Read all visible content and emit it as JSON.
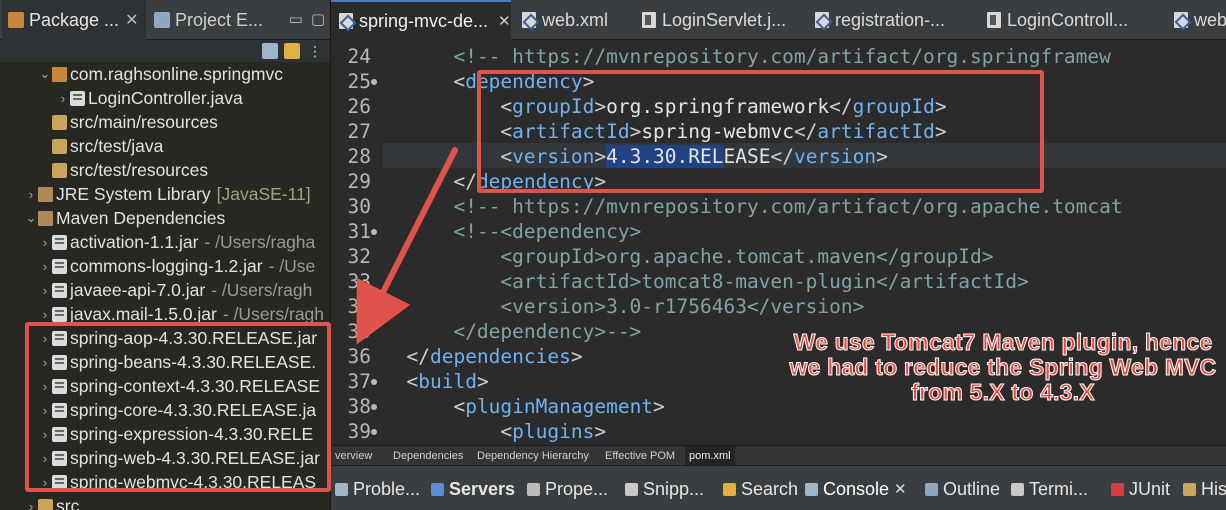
{
  "left_panel": {
    "tabs": [
      {
        "label": "Package ...",
        "closable": true
      },
      {
        "label": "Project E...",
        "closable": false
      }
    ],
    "tree": [
      {
        "label": "com.raghsonline.springmvc",
        "decoration": "",
        "icon": "package-icon",
        "expanded": true
      },
      {
        "label": "LoginController.java",
        "decoration": "",
        "icon": "java-file-icon",
        "expanded": false
      },
      {
        "label": "src/main/resources",
        "decoration": "",
        "icon": "source-folder-icon"
      },
      {
        "label": "src/test/java",
        "decoration": "",
        "icon": "source-folder-icon"
      },
      {
        "label": "src/test/resources",
        "decoration": "",
        "icon": "source-folder-icon"
      },
      {
        "label": "JRE System Library",
        "decoration": "[JavaSE-11]",
        "icon": "library-icon",
        "expanded": false
      },
      {
        "label": "Maven Dependencies",
        "decoration": "",
        "icon": "library-icon",
        "expanded": true
      },
      {
        "label": "activation-1.1.jar",
        "decoration": "- /Users/ragha",
        "icon": "jar-icon"
      },
      {
        "label": "commons-logging-1.2.jar",
        "decoration": "- /Use",
        "icon": "jar-icon"
      },
      {
        "label": "javaee-api-7.0.jar",
        "decoration": "- /Users/ragh",
        "icon": "jar-icon"
      },
      {
        "label": "javax.mail-1.5.0.jar",
        "decoration": "- /Users/ragh",
        "icon": "jar-icon"
      },
      {
        "label": "spring-aop-4.3.30.RELEASE.jar",
        "decoration": "",
        "icon": "jar-icon"
      },
      {
        "label": "spring-beans-4.3.30.RELEASE.",
        "decoration": "",
        "icon": "jar-icon"
      },
      {
        "label": "spring-context-4.3.30.RELEASE",
        "decoration": "",
        "icon": "jar-icon"
      },
      {
        "label": "spring-core-4.3.30.RELEASE.ja",
        "decoration": "",
        "icon": "jar-icon"
      },
      {
        "label": "spring-expression-4.3.30.RELE",
        "decoration": "",
        "icon": "jar-icon"
      },
      {
        "label": "spring-web-4.3.30.RELEASE.jar",
        "decoration": "",
        "icon": "jar-icon"
      },
      {
        "label": "spring-webmvc-4.3.30.RELEAS",
        "decoration": "",
        "icon": "jar-icon"
      },
      {
        "label": "src",
        "decoration": "",
        "icon": "folder-icon"
      }
    ]
  },
  "editor": {
    "tabs": [
      {
        "label": "spring-mvc-de...",
        "active": true,
        "closable": true,
        "icon": "xml-file-icon"
      },
      {
        "label": "web.xml",
        "active": false,
        "icon": "xml-file-icon"
      },
      {
        "label": "LoginServlet.j...",
        "active": false,
        "icon": "java-file-icon"
      },
      {
        "label": "registration-...",
        "active": false,
        "icon": "xml-file-icon"
      },
      {
        "label": "LoginControll...",
        "active": false,
        "icon": "java-file-icon"
      },
      {
        "label": "web.x",
        "active": false,
        "icon": "xml-file-icon"
      }
    ],
    "lines": [
      {
        "num": "24",
        "fold": false,
        "indent": "      ",
        "tokens": [
          {
            "t": "<!-- https://mvnrepository.com/artifact/org.springframew",
            "c": "cmt"
          }
        ]
      },
      {
        "num": "25",
        "fold": true,
        "indent": "      ",
        "tokens": [
          {
            "t": "<",
            "c": "br"
          },
          {
            "t": "dependency",
            "c": "tag"
          },
          {
            "t": ">",
            "c": "br"
          }
        ]
      },
      {
        "num": "26",
        "fold": false,
        "indent": "          ",
        "tokens": [
          {
            "t": "<",
            "c": "br"
          },
          {
            "t": "groupId",
            "c": "tag"
          },
          {
            "t": ">",
            "c": "br"
          },
          {
            "t": "org.springframework",
            "c": "txt"
          },
          {
            "t": "</",
            "c": "br"
          },
          {
            "t": "groupId",
            "c": "tag"
          },
          {
            "t": ">",
            "c": "br"
          }
        ]
      },
      {
        "num": "27",
        "fold": false,
        "indent": "          ",
        "tokens": [
          {
            "t": "<",
            "c": "br"
          },
          {
            "t": "artifactId",
            "c": "tag"
          },
          {
            "t": ">",
            "c": "br"
          },
          {
            "t": "spring-webmvc",
            "c": "txt"
          },
          {
            "t": "</",
            "c": "br"
          },
          {
            "t": "artifactId",
            "c": "tag"
          },
          {
            "t": ">",
            "c": "br"
          }
        ]
      },
      {
        "num": "28",
        "fold": false,
        "indent": "          ",
        "tokens": [
          {
            "t": "<",
            "c": "br"
          },
          {
            "t": "version",
            "c": "tag"
          },
          {
            "t": ">",
            "c": "br"
          },
          {
            "t": "4.3.30.REL",
            "c": "sel"
          },
          {
            "t": "EASE",
            "c": "txt"
          },
          {
            "t": "</",
            "c": "br"
          },
          {
            "t": "version",
            "c": "tag"
          },
          {
            "t": ">",
            "c": "br"
          }
        ]
      },
      {
        "num": "29",
        "fold": false,
        "indent": "      ",
        "tokens": [
          {
            "t": "</",
            "c": "br"
          },
          {
            "t": "dependency",
            "c": "tag"
          },
          {
            "t": ">",
            "c": "br"
          }
        ]
      },
      {
        "num": "30",
        "fold": false,
        "indent": "      ",
        "tokens": [
          {
            "t": "<!-- https://mvnrepository.com/artifact/org.apache.tomcat",
            "c": "cmt"
          }
        ]
      },
      {
        "num": "31",
        "fold": true,
        "indent": "      ",
        "tokens": [
          {
            "t": "<!--<dependency>",
            "c": "cmt"
          }
        ]
      },
      {
        "num": "32",
        "fold": false,
        "indent": "          ",
        "tokens": [
          {
            "t": "<groupId>org.apache.tomcat.maven</groupId>",
            "c": "cmt"
          }
        ]
      },
      {
        "num": "33",
        "fold": false,
        "indent": "          ",
        "tokens": [
          {
            "t": "<artifactId>tomcat8-maven-plugin</artifactId>",
            "c": "cmt"
          }
        ]
      },
      {
        "num": "34",
        "fold": false,
        "indent": "          ",
        "tokens": [
          {
            "t": "<version>3.0-r1756463</version>",
            "c": "cmt"
          }
        ]
      },
      {
        "num": "35",
        "fold": false,
        "indent": "      ",
        "tokens": [
          {
            "t": "</dependency>-->",
            "c": "cmt"
          }
        ]
      },
      {
        "num": "36",
        "fold": false,
        "indent": "  ",
        "tokens": [
          {
            "t": "</",
            "c": "br"
          },
          {
            "t": "dependencies",
            "c": "tag"
          },
          {
            "t": ">",
            "c": "br"
          }
        ]
      },
      {
        "num": "37",
        "fold": true,
        "indent": "  ",
        "tokens": [
          {
            "t": "<",
            "c": "br"
          },
          {
            "t": "build",
            "c": "tag"
          },
          {
            "t": ">",
            "c": "br"
          }
        ]
      },
      {
        "num": "38",
        "fold": true,
        "indent": "      ",
        "tokens": [
          {
            "t": "<",
            "c": "br"
          },
          {
            "t": "pluginManagement",
            "c": "tag"
          },
          {
            "t": ">",
            "c": "br"
          }
        ]
      },
      {
        "num": "39",
        "fold": true,
        "indent": "          ",
        "tokens": [
          {
            "t": "<",
            "c": "br"
          },
          {
            "t": "plugins",
            "c": "tag"
          },
          {
            "t": ">",
            "c": "br"
          }
        ]
      }
    ],
    "bottom_tabs": [
      {
        "label": "verview",
        "active": false
      },
      {
        "label": "Dependencies",
        "active": false
      },
      {
        "label": "Dependency Hierarchy",
        "active": false
      },
      {
        "label": "Effective POM",
        "active": false
      },
      {
        "label": "pom.xml",
        "active": true
      }
    ]
  },
  "views_bar": {
    "tabs": [
      {
        "label": "Proble...",
        "icon": "problems-icon"
      },
      {
        "label": "Servers",
        "icon": "servers-icon",
        "bold": true
      },
      {
        "label": "Prope...",
        "icon": "properties-icon"
      },
      {
        "label": "Snipp...",
        "icon": "snippets-icon"
      },
      {
        "label": "Search",
        "icon": "search-icon"
      },
      {
        "label": "Console",
        "icon": "console-icon",
        "active": true,
        "closable": true
      },
      {
        "label": "Outline",
        "icon": "outline-icon"
      },
      {
        "label": "Termi...",
        "icon": "terminal-icon"
      },
      {
        "label": "JUnit",
        "icon": "junit-icon"
      },
      {
        "label": "His",
        "icon": "history-icon"
      }
    ]
  },
  "annotation": {
    "text": "We use Tomcat7 Maven plugin, hence we had to reduce the Spring Web MVC from 5.X to 4.3.X",
    "color": "#e0534a"
  }
}
